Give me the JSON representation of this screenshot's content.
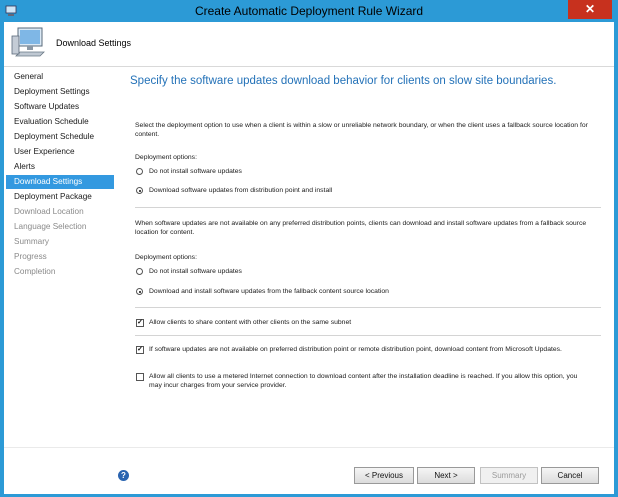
{
  "window": {
    "title": "Create Automatic Deployment Rule Wizard",
    "close_glyph": "✕",
    "title_icon": "wizard-icon"
  },
  "header": {
    "title": "Download Settings",
    "icon": "computer-icon"
  },
  "sidebar": {
    "items": [
      {
        "label": "General",
        "state": "normal"
      },
      {
        "label": "Deployment Settings",
        "state": "normal"
      },
      {
        "label": "Software Updates",
        "state": "normal"
      },
      {
        "label": "Evaluation Schedule",
        "state": "normal"
      },
      {
        "label": "Deployment Schedule",
        "state": "normal"
      },
      {
        "label": "User Experience",
        "state": "normal"
      },
      {
        "label": "Alerts",
        "state": "normal"
      },
      {
        "label": "Download Settings",
        "state": "active"
      },
      {
        "label": "Deployment Package",
        "state": "normal"
      },
      {
        "label": "Download Location",
        "state": "disabled"
      },
      {
        "label": "Language Selection",
        "state": "disabled"
      },
      {
        "label": "Summary",
        "state": "disabled"
      },
      {
        "label": "Progress",
        "state": "disabled"
      },
      {
        "label": "Completion",
        "state": "disabled"
      }
    ]
  },
  "main": {
    "heading": "Specify the software updates download behavior for clients on slow site boundaries.",
    "intro": "Select the deployment option to use when a client is within a slow or unreliable network boundary, or when the client uses a fallback source location for content.",
    "group1": {
      "label": "Deployment options:",
      "options": [
        {
          "label": "Do not install software updates",
          "checked": false
        },
        {
          "label": "Download software updates from distribution point and install",
          "checked": true
        }
      ]
    },
    "fallback_text": "When software updates are not available on any preferred distribution points, clients can download and install software updates from a fallback source location for content.",
    "group2": {
      "label": "Deployment options:",
      "options": [
        {
          "label": "Do not install software updates",
          "checked": false
        },
        {
          "label": "Download and install software updates from the fallback content source location",
          "checked": true
        }
      ]
    },
    "share_subnet": {
      "label": "Allow clients to share content with other clients on the same subnet",
      "checked": true
    },
    "microsoft_updates": {
      "label": "If software updates are not available on preferred distribution point or remote distribution point, download content from Microsoft Updates.",
      "checked": true
    },
    "metered": {
      "label": "Allow all clients to use a metered Internet connection to download content after the installation deadline is reached. If you allow this option, you may incur charges from your service provider.",
      "checked": false
    }
  },
  "footer": {
    "help_glyph": "?",
    "previous": "< Previous",
    "next": "Next >",
    "summary": "Summary",
    "cancel": "Cancel"
  },
  "colors": {
    "window_frame": "#2c9ad6",
    "heading": "#2472b8",
    "nav_active": "#3399e0",
    "close_button": "#c7311e"
  }
}
